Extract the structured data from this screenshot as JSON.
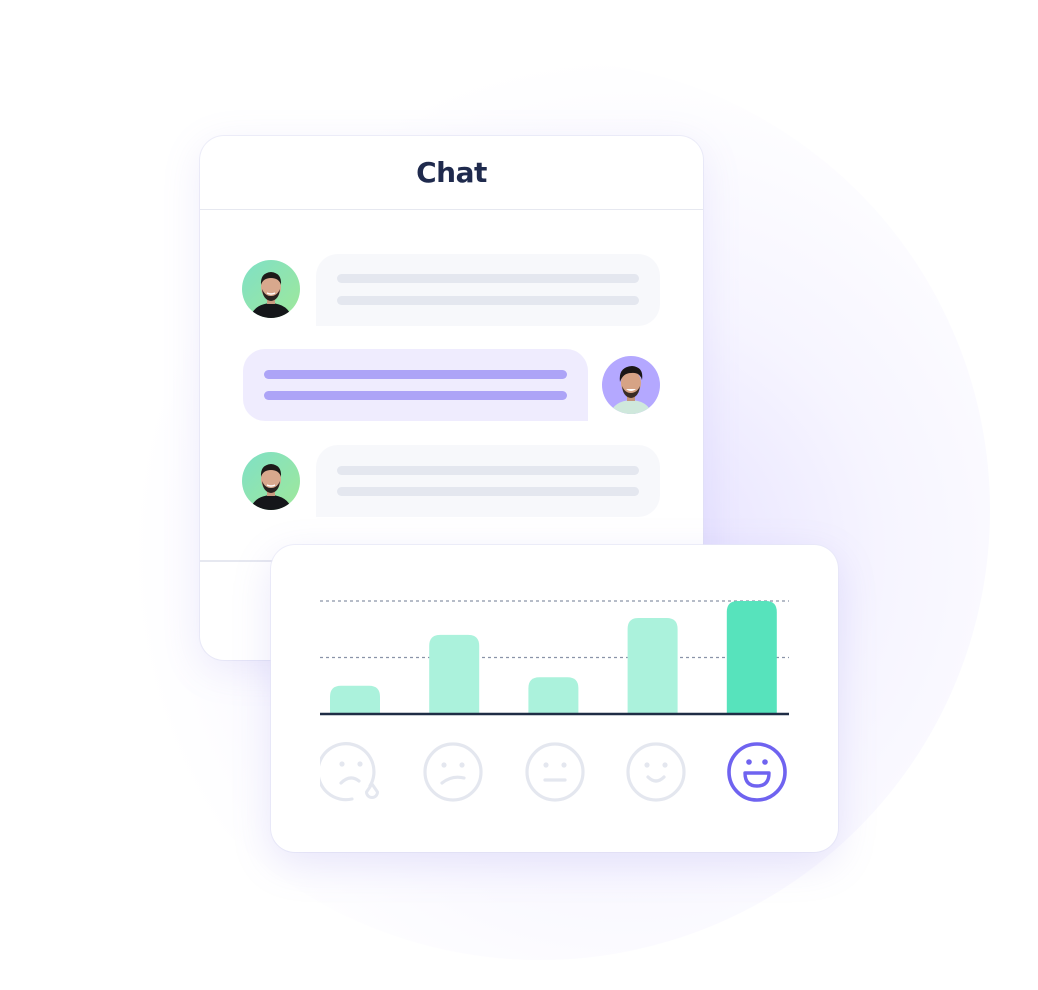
{
  "chat": {
    "title": "Chat",
    "messages": [
      {
        "direction": "incoming",
        "sender": "agent",
        "avatar_bg": "green"
      },
      {
        "direction": "outgoing",
        "sender": "customer",
        "avatar_bg": "purple"
      },
      {
        "direction": "incoming",
        "sender": "agent",
        "avatar_bg": "green"
      }
    ]
  },
  "colors": {
    "title_text": "#1f2a4d",
    "bar_light": "#abf2dc",
    "bar_selected": "#57e3bc",
    "axis": "#1f2d45",
    "grid": "#8a93a8",
    "emoji_inactive": "#e4e7ef",
    "emoji_active": "#6f63f0",
    "outgoing_bubble": "#efecfe",
    "outgoing_line": "#ada4f7",
    "incoming_bubble": "#f7f8fb",
    "incoming_line": "#e4e7ef"
  },
  "rating": {
    "emojis": [
      {
        "name": "crying-face-icon",
        "label": "very dissatisfied",
        "selected": false
      },
      {
        "name": "confused-face-icon",
        "label": "dissatisfied",
        "selected": false
      },
      {
        "name": "neutral-face-icon",
        "label": "neutral",
        "selected": false
      },
      {
        "name": "smiling-face-icon",
        "label": "satisfied",
        "selected": false
      },
      {
        "name": "grinning-face-icon",
        "label": "very satisfied",
        "selected": true
      }
    ]
  },
  "chart_data": {
    "type": "bar",
    "title": "",
    "xlabel": "",
    "ylabel": "",
    "categories": [
      "very dissatisfied",
      "dissatisfied",
      "neutral",
      "satisfied",
      "very satisfied"
    ],
    "values": [
      0.5,
      1.4,
      0.65,
      1.7,
      2.0
    ],
    "highlighted_index": 4,
    "ylim": [
      0,
      2
    ],
    "gridlines": [
      1,
      2
    ],
    "grid": true,
    "legend": "none"
  }
}
